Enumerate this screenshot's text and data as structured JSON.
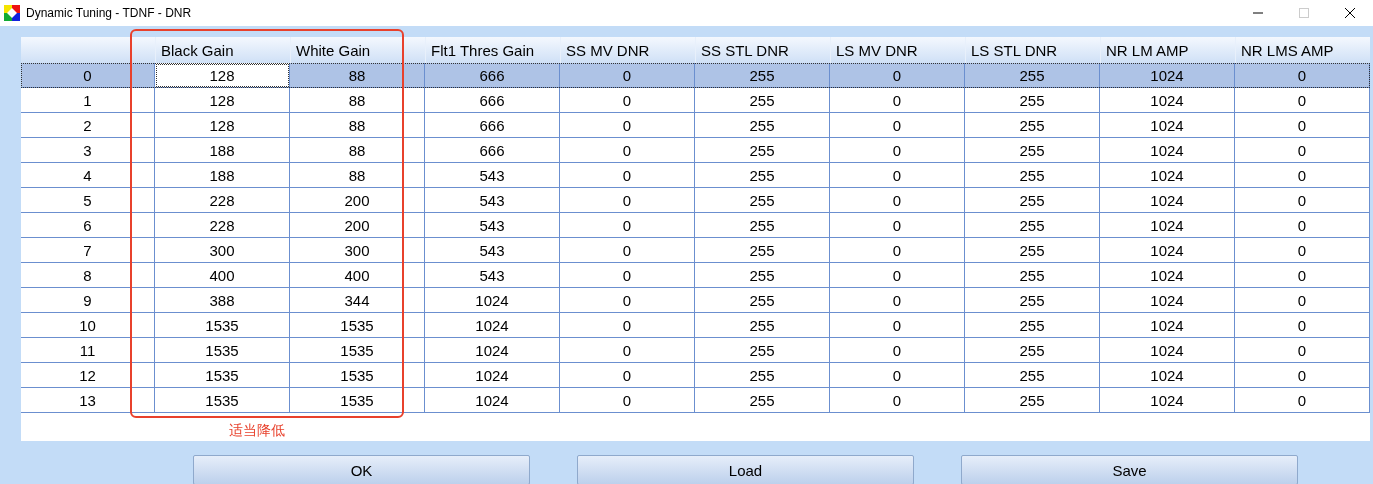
{
  "window": {
    "title": "Dynamic Tuning - TDNF - DNR",
    "maximize_disabled": true
  },
  "table": {
    "columns": [
      "Black Gain",
      "White Gain",
      "Flt1 Thres Gain",
      "SS MV DNR",
      "SS STL DNR",
      "LS MV DNR",
      "LS STL DNR",
      "NR LM AMP",
      "NR LMS AMP"
    ],
    "rows": [
      {
        "label": "0",
        "selected": true,
        "cells": [
          {
            "value": "128",
            "focused": true
          },
          {
            "value": "88",
            "focused": false
          },
          {
            "value": "666",
            "focused": false
          },
          {
            "value": "0",
            "focused": false
          },
          {
            "value": "255",
            "focused": false
          },
          {
            "value": "0",
            "focused": false
          },
          {
            "value": "255",
            "focused": false
          },
          {
            "value": "1024",
            "focused": false
          },
          {
            "value": "0",
            "focused": false
          }
        ]
      },
      {
        "label": "1",
        "selected": false,
        "cells": [
          {
            "value": "128",
            "focused": false
          },
          {
            "value": "88",
            "focused": false
          },
          {
            "value": "666",
            "focused": false
          },
          {
            "value": "0",
            "focused": false
          },
          {
            "value": "255",
            "focused": false
          },
          {
            "value": "0",
            "focused": false
          },
          {
            "value": "255",
            "focused": false
          },
          {
            "value": "1024",
            "focused": false
          },
          {
            "value": "0",
            "focused": false
          }
        ]
      },
      {
        "label": "2",
        "selected": false,
        "cells": [
          {
            "value": "128",
            "focused": false
          },
          {
            "value": "88",
            "focused": false
          },
          {
            "value": "666",
            "focused": false
          },
          {
            "value": "0",
            "focused": false
          },
          {
            "value": "255",
            "focused": false
          },
          {
            "value": "0",
            "focused": false
          },
          {
            "value": "255",
            "focused": false
          },
          {
            "value": "1024",
            "focused": false
          },
          {
            "value": "0",
            "focused": false
          }
        ]
      },
      {
        "label": "3",
        "selected": false,
        "cells": [
          {
            "value": "188",
            "focused": false
          },
          {
            "value": "88",
            "focused": false
          },
          {
            "value": "666",
            "focused": false
          },
          {
            "value": "0",
            "focused": false
          },
          {
            "value": "255",
            "focused": false
          },
          {
            "value": "0",
            "focused": false
          },
          {
            "value": "255",
            "focused": false
          },
          {
            "value": "1024",
            "focused": false
          },
          {
            "value": "0",
            "focused": false
          }
        ]
      },
      {
        "label": "4",
        "selected": false,
        "cells": [
          {
            "value": "188",
            "focused": false
          },
          {
            "value": "88",
            "focused": false
          },
          {
            "value": "543",
            "focused": false
          },
          {
            "value": "0",
            "focused": false
          },
          {
            "value": "255",
            "focused": false
          },
          {
            "value": "0",
            "focused": false
          },
          {
            "value": "255",
            "focused": false
          },
          {
            "value": "1024",
            "focused": false
          },
          {
            "value": "0",
            "focused": false
          }
        ]
      },
      {
        "label": "5",
        "selected": false,
        "cells": [
          {
            "value": "228",
            "focused": false
          },
          {
            "value": "200",
            "focused": false
          },
          {
            "value": "543",
            "focused": false
          },
          {
            "value": "0",
            "focused": false
          },
          {
            "value": "255",
            "focused": false
          },
          {
            "value": "0",
            "focused": false
          },
          {
            "value": "255",
            "focused": false
          },
          {
            "value": "1024",
            "focused": false
          },
          {
            "value": "0",
            "focused": false
          }
        ]
      },
      {
        "label": "6",
        "selected": false,
        "cells": [
          {
            "value": "228",
            "focused": false
          },
          {
            "value": "200",
            "focused": false
          },
          {
            "value": "543",
            "focused": false
          },
          {
            "value": "0",
            "focused": false
          },
          {
            "value": "255",
            "focused": false
          },
          {
            "value": "0",
            "focused": false
          },
          {
            "value": "255",
            "focused": false
          },
          {
            "value": "1024",
            "focused": false
          },
          {
            "value": "0",
            "focused": false
          }
        ]
      },
      {
        "label": "7",
        "selected": false,
        "cells": [
          {
            "value": "300",
            "focused": false
          },
          {
            "value": "300",
            "focused": false
          },
          {
            "value": "543",
            "focused": false
          },
          {
            "value": "0",
            "focused": false
          },
          {
            "value": "255",
            "focused": false
          },
          {
            "value": "0",
            "focused": false
          },
          {
            "value": "255",
            "focused": false
          },
          {
            "value": "1024",
            "focused": false
          },
          {
            "value": "0",
            "focused": false
          }
        ]
      },
      {
        "label": "8",
        "selected": false,
        "cells": [
          {
            "value": "400",
            "focused": false
          },
          {
            "value": "400",
            "focused": false
          },
          {
            "value": "543",
            "focused": false
          },
          {
            "value": "0",
            "focused": false
          },
          {
            "value": "255",
            "focused": false
          },
          {
            "value": "0",
            "focused": false
          },
          {
            "value": "255",
            "focused": false
          },
          {
            "value": "1024",
            "focused": false
          },
          {
            "value": "0",
            "focused": false
          }
        ]
      },
      {
        "label": "9",
        "selected": false,
        "cells": [
          {
            "value": "388",
            "focused": false
          },
          {
            "value": "344",
            "focused": false
          },
          {
            "value": "1024",
            "focused": false
          },
          {
            "value": "0",
            "focused": false
          },
          {
            "value": "255",
            "focused": false
          },
          {
            "value": "0",
            "focused": false
          },
          {
            "value": "255",
            "focused": false
          },
          {
            "value": "1024",
            "focused": false
          },
          {
            "value": "0",
            "focused": false
          }
        ]
      },
      {
        "label": "10",
        "selected": false,
        "cells": [
          {
            "value": "1535",
            "focused": false
          },
          {
            "value": "1535",
            "focused": false
          },
          {
            "value": "1024",
            "focused": false
          },
          {
            "value": "0",
            "focused": false
          },
          {
            "value": "255",
            "focused": false
          },
          {
            "value": "0",
            "focused": false
          },
          {
            "value": "255",
            "focused": false
          },
          {
            "value": "1024",
            "focused": false
          },
          {
            "value": "0",
            "focused": false
          }
        ]
      },
      {
        "label": "11",
        "selected": false,
        "cells": [
          {
            "value": "1535",
            "focused": false
          },
          {
            "value": "1535",
            "focused": false
          },
          {
            "value": "1024",
            "focused": false
          },
          {
            "value": "0",
            "focused": false
          },
          {
            "value": "255",
            "focused": false
          },
          {
            "value": "0",
            "focused": false
          },
          {
            "value": "255",
            "focused": false
          },
          {
            "value": "1024",
            "focused": false
          },
          {
            "value": "0",
            "focused": false
          }
        ]
      },
      {
        "label": "12",
        "selected": false,
        "cells": [
          {
            "value": "1535",
            "focused": false
          },
          {
            "value": "1535",
            "focused": false
          },
          {
            "value": "1024",
            "focused": false
          },
          {
            "value": "0",
            "focused": false
          },
          {
            "value": "255",
            "focused": false
          },
          {
            "value": "0",
            "focused": false
          },
          {
            "value": "255",
            "focused": false
          },
          {
            "value": "1024",
            "focused": false
          },
          {
            "value": "0",
            "focused": false
          }
        ]
      },
      {
        "label": "13",
        "selected": false,
        "cells": [
          {
            "value": "1535",
            "focused": false
          },
          {
            "value": "1535",
            "focused": false
          },
          {
            "value": "1024",
            "focused": false
          },
          {
            "value": "0",
            "focused": false
          },
          {
            "value": "255",
            "focused": false
          },
          {
            "value": "0",
            "focused": false
          },
          {
            "value": "255",
            "focused": false
          },
          {
            "value": "1024",
            "focused": false
          },
          {
            "value": "0",
            "focused": false
          }
        ]
      }
    ]
  },
  "annotation": {
    "note": "适当降低",
    "color": "#e8412c"
  },
  "buttons": [
    "OK",
    "Load",
    "Save"
  ]
}
